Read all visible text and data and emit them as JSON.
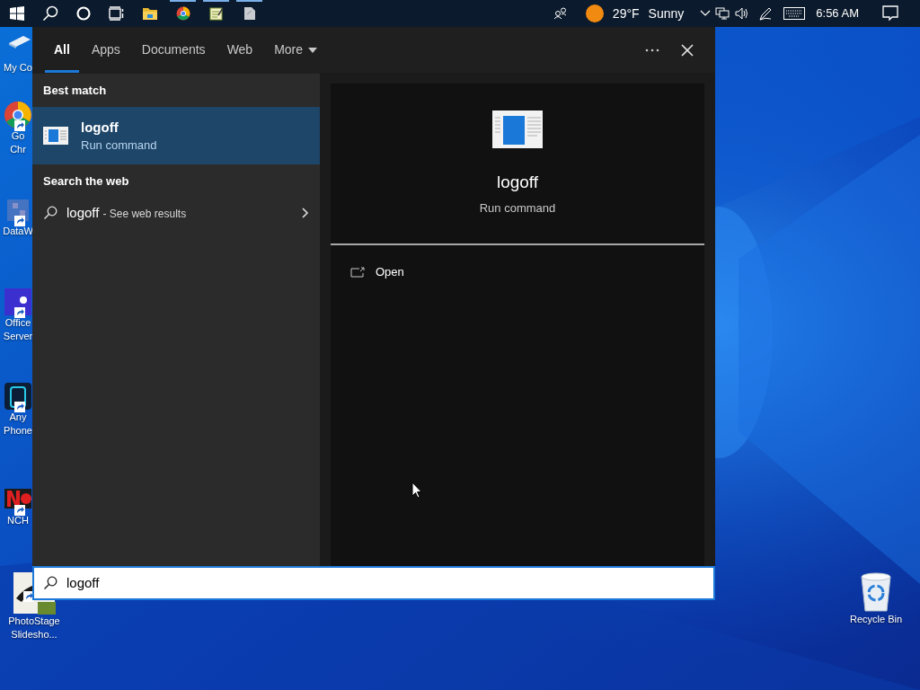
{
  "taskbar": {
    "pinned": [
      {
        "kind": "start",
        "running": false
      },
      {
        "kind": "search",
        "running": false
      },
      {
        "kind": "cortana",
        "running": false
      },
      {
        "kind": "taskview",
        "running": false
      },
      {
        "kind": "explorer",
        "running": false
      },
      {
        "kind": "chrome",
        "running": true
      },
      {
        "kind": "notepad",
        "running": true
      },
      {
        "kind": "app",
        "running": true
      }
    ],
    "weather": {
      "temperature": "29°F",
      "condition": "Sunny"
    },
    "clock": "6:56 AM"
  },
  "desktop": {
    "icons": [
      {
        "kind": "computer",
        "lines": [
          "My Co"
        ]
      },
      {
        "kind": "chrome",
        "lines": [
          "Go",
          "Chr"
        ]
      },
      {
        "kind": "data",
        "lines": [
          "DataW"
        ]
      },
      {
        "kind": "office",
        "lines": [
          "Office",
          "Server"
        ]
      },
      {
        "kind": "phone",
        "lines": [
          "Any",
          "Phone"
        ]
      },
      {
        "kind": "nch",
        "lines": [
          "NCH"
        ]
      },
      {
        "kind": "photostage",
        "lines": [
          "PhotoStage",
          "Slidesho..."
        ]
      },
      {
        "kind": "recycle",
        "lines": [
          "Recycle Bin"
        ]
      }
    ]
  },
  "search_panel": {
    "tabs": [
      {
        "label": "All",
        "selected": true,
        "dropdown": false
      },
      {
        "label": "Apps",
        "selected": false,
        "dropdown": false
      },
      {
        "label": "Documents",
        "selected": false,
        "dropdown": false
      },
      {
        "label": "Web",
        "selected": false,
        "dropdown": false
      },
      {
        "label": "More",
        "selected": false,
        "dropdown": true
      }
    ],
    "sections": [
      {
        "heading": "Best match",
        "items": [
          {
            "kind": "app",
            "title": "logoff",
            "subtitle": "Run command",
            "selected": true
          }
        ]
      },
      {
        "heading": "Search the web",
        "items": [
          {
            "kind": "web",
            "title": "logoff",
            "subtitle": "- See web results",
            "selected": false
          }
        ]
      }
    ],
    "preview": {
      "title": "logoff",
      "subtitle": "Run command",
      "actions": [
        "Open"
      ]
    },
    "search_box": {
      "value": "logoff"
    }
  }
}
